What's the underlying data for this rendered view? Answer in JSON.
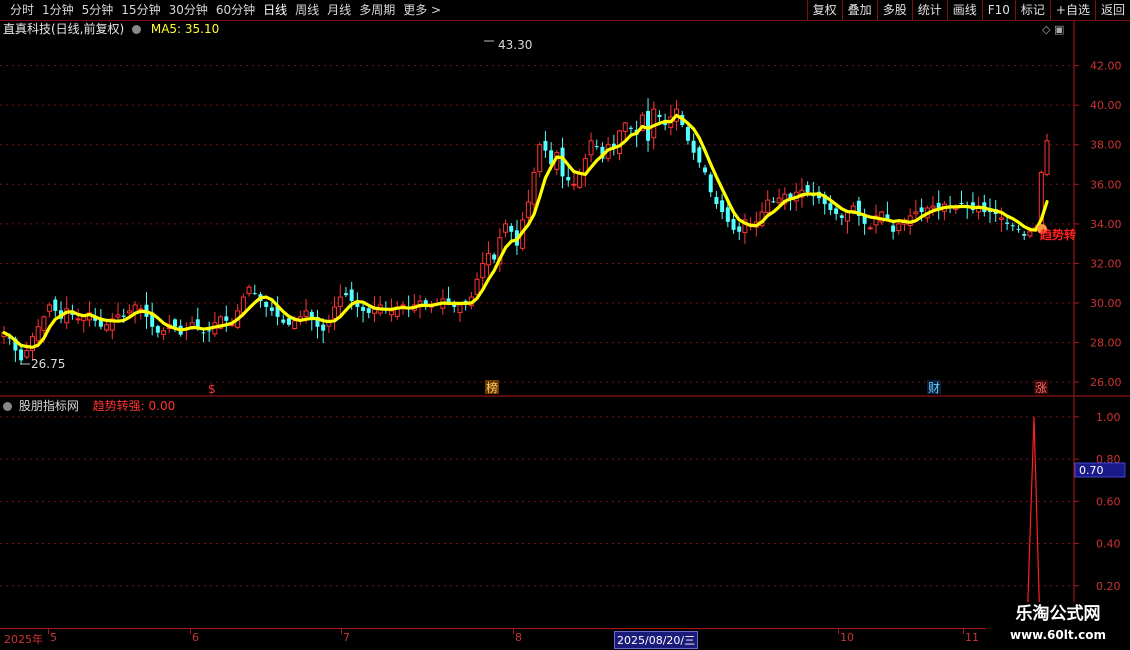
{
  "toolbar": {
    "periods": [
      "分时",
      "1分钟",
      "5分钟",
      "15分钟",
      "30分钟",
      "60分钟",
      "日线",
      "周线",
      "月线",
      "多周期",
      "更多 >"
    ],
    "active_period": "日线",
    "tools": [
      "复权",
      "叠加",
      "多股",
      "统计",
      "画线",
      "F10",
      "标记",
      "+自选",
      "返回"
    ]
  },
  "header": {
    "stock_title": "直真科技(日线,前复权)",
    "ma_label": "MA5: 35.10"
  },
  "indicator": {
    "name": "股朋指标网",
    "value_label": "趋势转强: 0.00",
    "signal_label": "趋势转",
    "current_value_box": "0.70"
  },
  "price_axis": {
    "ticks": [
      "42.00",
      "40.00",
      "38.00",
      "36.00",
      "34.00",
      "32.00",
      "30.00",
      "28.00",
      "26.00"
    ],
    "high_label": "43.30",
    "low_label": "26.75"
  },
  "indicator_axis": {
    "ticks": [
      "1.00",
      "0.80",
      "0.60",
      "0.40",
      "0.20"
    ]
  },
  "date_axis": {
    "labels": [
      "2025年",
      "5",
      "6",
      "7",
      "8",
      "2025/08/20/三",
      "10",
      "11"
    ]
  },
  "markers": [
    "$",
    "榜",
    "财",
    "涨"
  ],
  "watermark": {
    "line1": "乐淘公式网",
    "line2": "www.60lt.com"
  },
  "colors": {
    "up": "#ff3333",
    "down": "#54ffff",
    "ma": "#ffff00",
    "grid": "#7a1010",
    "signal": "#ff2020"
  },
  "chart_data": {
    "type": "candlestick",
    "ma_period": 5,
    "price_range": [
      25.3,
      43.9
    ],
    "indicator_range": [
      0,
      1.08
    ],
    "closes": [
      28.5,
      28.2,
      27.6,
      27.1,
      27.6,
      28.3,
      28.8,
      29.3,
      29.9,
      29.6,
      29.2,
      29.7,
      29.4,
      29.2,
      29.3,
      29.5,
      29.1,
      28.8,
      28.9,
      29.2,
      29.4,
      29.3,
      29.6,
      29.9,
      29.7,
      29.3,
      28.8,
      28.5,
      28.6,
      28.9,
      28.8,
      28.4,
      28.7,
      29.0,
      28.8,
      28.5,
      28.6,
      29.0,
      29.3,
      29.1,
      28.9,
      29.6,
      30.3,
      30.8,
      30.5,
      30.1,
      29.8,
      29.6,
      29.3,
      29.0,
      28.9,
      29.1,
      29.3,
      29.6,
      29.2,
      28.8,
      28.6,
      29.1,
      29.8,
      30.3,
      30.4,
      30.1,
      29.8,
      29.6,
      29.5,
      29.7,
      29.9,
      29.7,
      29.6,
      29.8,
      29.9,
      29.7,
      29.9,
      30.1,
      29.8,
      29.9,
      30.0,
      30.2,
      30.0,
      29.8,
      29.9,
      30.0,
      30.3,
      31.2,
      32.0,
      32.5,
      32.2,
      33.3,
      34.0,
      33.6,
      32.9,
      34.2,
      35.1,
      36.6,
      38.0,
      37.7,
      37.0,
      37.6,
      36.4,
      36.2,
      36.0,
      36.6,
      37.3,
      38.2,
      37.9,
      37.3,
      38.0,
      37.8,
      38.7,
      39.1,
      38.8,
      38.5,
      39.5,
      38.2,
      39.8,
      39.4,
      39.0,
      39.4,
      39.8,
      39.0,
      38.2,
      37.6,
      37.1,
      36.6,
      35.6,
      35.0,
      34.6,
      34.1,
      33.7,
      33.6,
      34.2,
      34.0,
      34.1,
      34.6,
      35.2,
      35.1,
      35.3,
      35.5,
      35.2,
      35.6,
      35.7,
      35.6,
      35.4,
      35.3,
      35.0,
      34.7,
      34.5,
      34.3,
      34.6,
      34.9,
      34.4,
      34.0,
      33.8,
      34.4,
      34.6,
      34.2,
      33.6,
      34.0,
      34.2,
      34.4,
      34.6,
      34.6,
      34.8,
      34.9,
      34.8,
      35.0,
      34.8,
      34.8,
      35.0,
      34.8,
      34.7,
      34.9,
      34.6,
      34.6,
      34.5,
      34.3,
      34.0,
      33.9,
      33.7,
      33.4,
      33.6,
      33.8,
      36.6,
      38.2
    ],
    "indicator": {
      "name": "趋势转强",
      "spike_value": 1.0,
      "spike_position": "last bars"
    }
  }
}
